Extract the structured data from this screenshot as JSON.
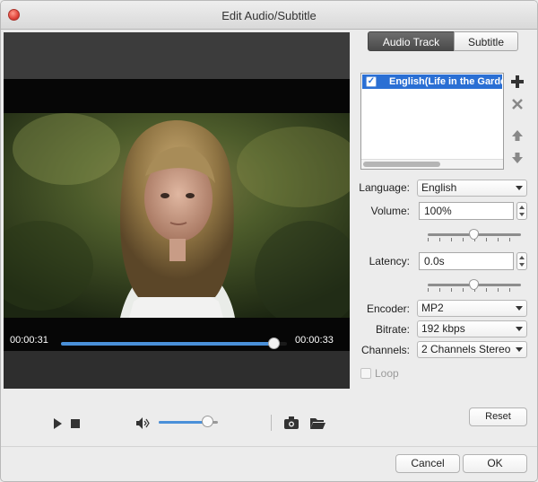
{
  "window": {
    "title": "Edit Audio/Subtitle"
  },
  "player": {
    "current_time": "00:00:31",
    "total_time": "00:00:33",
    "seek_progress": 0.94,
    "volume_level": 0.82
  },
  "tabs": [
    {
      "label": "Audio Track",
      "active": true
    },
    {
      "label": "Subtitle",
      "active": false
    }
  ],
  "tracks": [
    {
      "label": "English(Life in the Garden",
      "checked": true,
      "selected": true
    }
  ],
  "fields": {
    "language_label": "Language:",
    "language_value": "English",
    "volume_label": "Volume:",
    "volume_value": "100%",
    "volume_slider": 0.5,
    "latency_label": "Latency:",
    "latency_value": "0.0s",
    "latency_slider": 0.5,
    "encoder_label": "Encoder:",
    "encoder_value": "MP2",
    "bitrate_label": "Bitrate:",
    "bitrate_value": "192 kbps",
    "channels_label": "Channels:",
    "channels_value": "2 Channels Stereo"
  },
  "loop": {
    "label": "Loop",
    "checked": false
  },
  "buttons": {
    "reset": "Reset",
    "cancel": "Cancel",
    "ok": "OK"
  },
  "icons": {
    "add": "plus-icon",
    "remove": "x-icon",
    "up": "arrow-up-icon",
    "down": "arrow-down-icon",
    "play": "play-icon",
    "stop": "stop-icon",
    "volume": "speaker-icon",
    "snapshot": "camera-icon",
    "folder": "folder-icon"
  },
  "colors": {
    "accent": "#4a90d9",
    "selection": "#2a6fd4"
  }
}
